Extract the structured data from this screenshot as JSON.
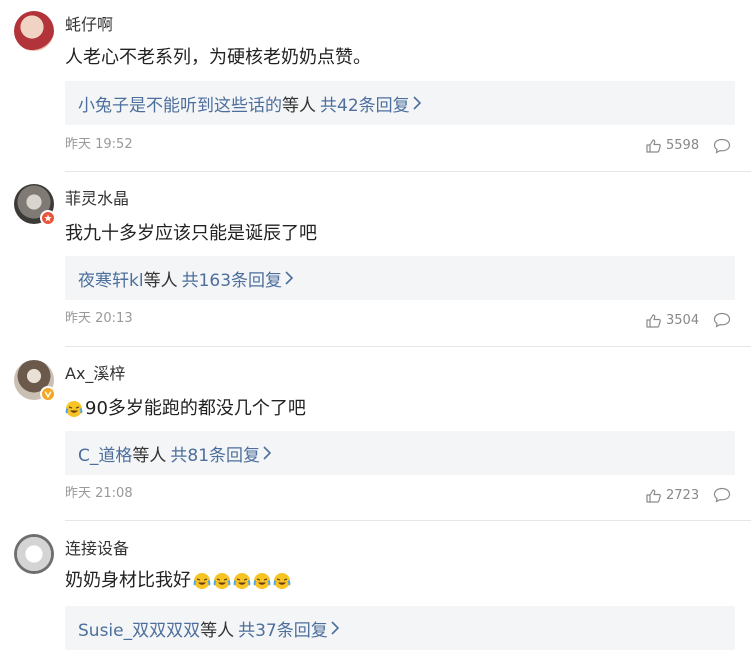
{
  "comments": [
    {
      "username": "蚝仔啊",
      "text": "人老心不老系列，为硬核老奶奶点赞。",
      "emoji_count": 0,
      "reply_names": "小兔子是不能听到这些话的",
      "reply_suffix": "等人",
      "reply_count": "共42条回复",
      "time": "昨天 19:52",
      "likes": "5598",
      "badge": "none"
    },
    {
      "username": "菲灵水晶",
      "text": "我九十多岁应该只能是诞辰了吧",
      "emoji_count": 0,
      "reply_names": "夜寒轩kl",
      "reply_suffix": "等人",
      "reply_count": "共163条回复",
      "time": "昨天 20:13",
      "likes": "3504",
      "badge": "red-star-badge"
    },
    {
      "username": "Ax_溪梓",
      "text": "90多岁能跑的都没几个了吧",
      "emoji_count": 1,
      "reply_names": "C_道格",
      "reply_suffix": "等人",
      "reply_count": "共81条回复",
      "time": "昨天 21:08",
      "likes": "2723",
      "badge": "gold-v-badge"
    },
    {
      "username": "连接设备",
      "text": "奶奶身材比我好",
      "emoji_count_after": 5,
      "reply_names": "Susie_双双双双",
      "reply_suffix": "等人",
      "reply_count": "共37条回复",
      "badge": "none"
    }
  ],
  "icons": {
    "like": "thumbs-up-icon",
    "reply": "comment-bubble-icon",
    "chevron": "chevron-right-icon",
    "emoji": "laughing-crying-emoji-icon"
  },
  "colors": {
    "link": "#4d6f9d",
    "reply_bg": "#f4f5f6",
    "meta": "#999999",
    "badge_red": "#e8543a",
    "badge_gold": "#f5a623"
  }
}
